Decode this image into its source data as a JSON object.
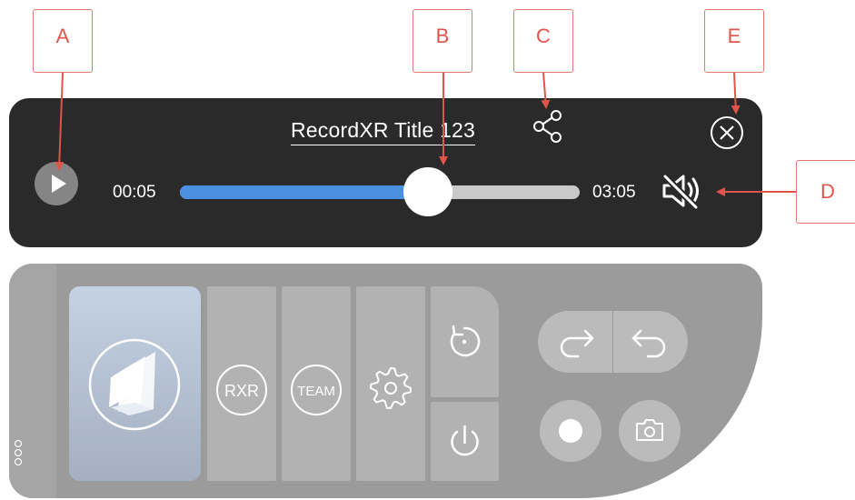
{
  "callouts": {
    "a": "A",
    "b": "B",
    "c": "C",
    "d": "D",
    "e": "E"
  },
  "player": {
    "title": "RecordXR Title 123",
    "time_current": "00:05",
    "time_total": "03:05",
    "progress": 0.62,
    "muted": true,
    "icons": {
      "play": "play-icon",
      "share": "share-icon",
      "close": "close-circle-icon",
      "mute": "speaker-muted-icon"
    }
  },
  "panel": {
    "home_tile_icon": "recordxr-logo-icon",
    "tiles": [
      {
        "label": "RXR",
        "icon": "rxr-icon"
      },
      {
        "label": "TEAM",
        "icon": "team-icon"
      },
      {
        "label": "",
        "icon": "gear-icon"
      }
    ],
    "reset_icon": "reset-icon",
    "power_icon": "power-icon",
    "redo_icon": "redo-arrow-icon",
    "undo_icon": "undo-arrow-icon",
    "record_icon": "record-dot-icon",
    "camera_icon": "camera-icon",
    "handle_icon": "drag-handle-icon"
  },
  "colors": {
    "player_bg": "#2a2a2a",
    "progress_fill": "#4a8fe0",
    "progress_track": "#c9c9c9",
    "panel_bg": "#9b9b9b",
    "tile_bg": "#b2b2b2",
    "callout_border": "#e07b73"
  }
}
